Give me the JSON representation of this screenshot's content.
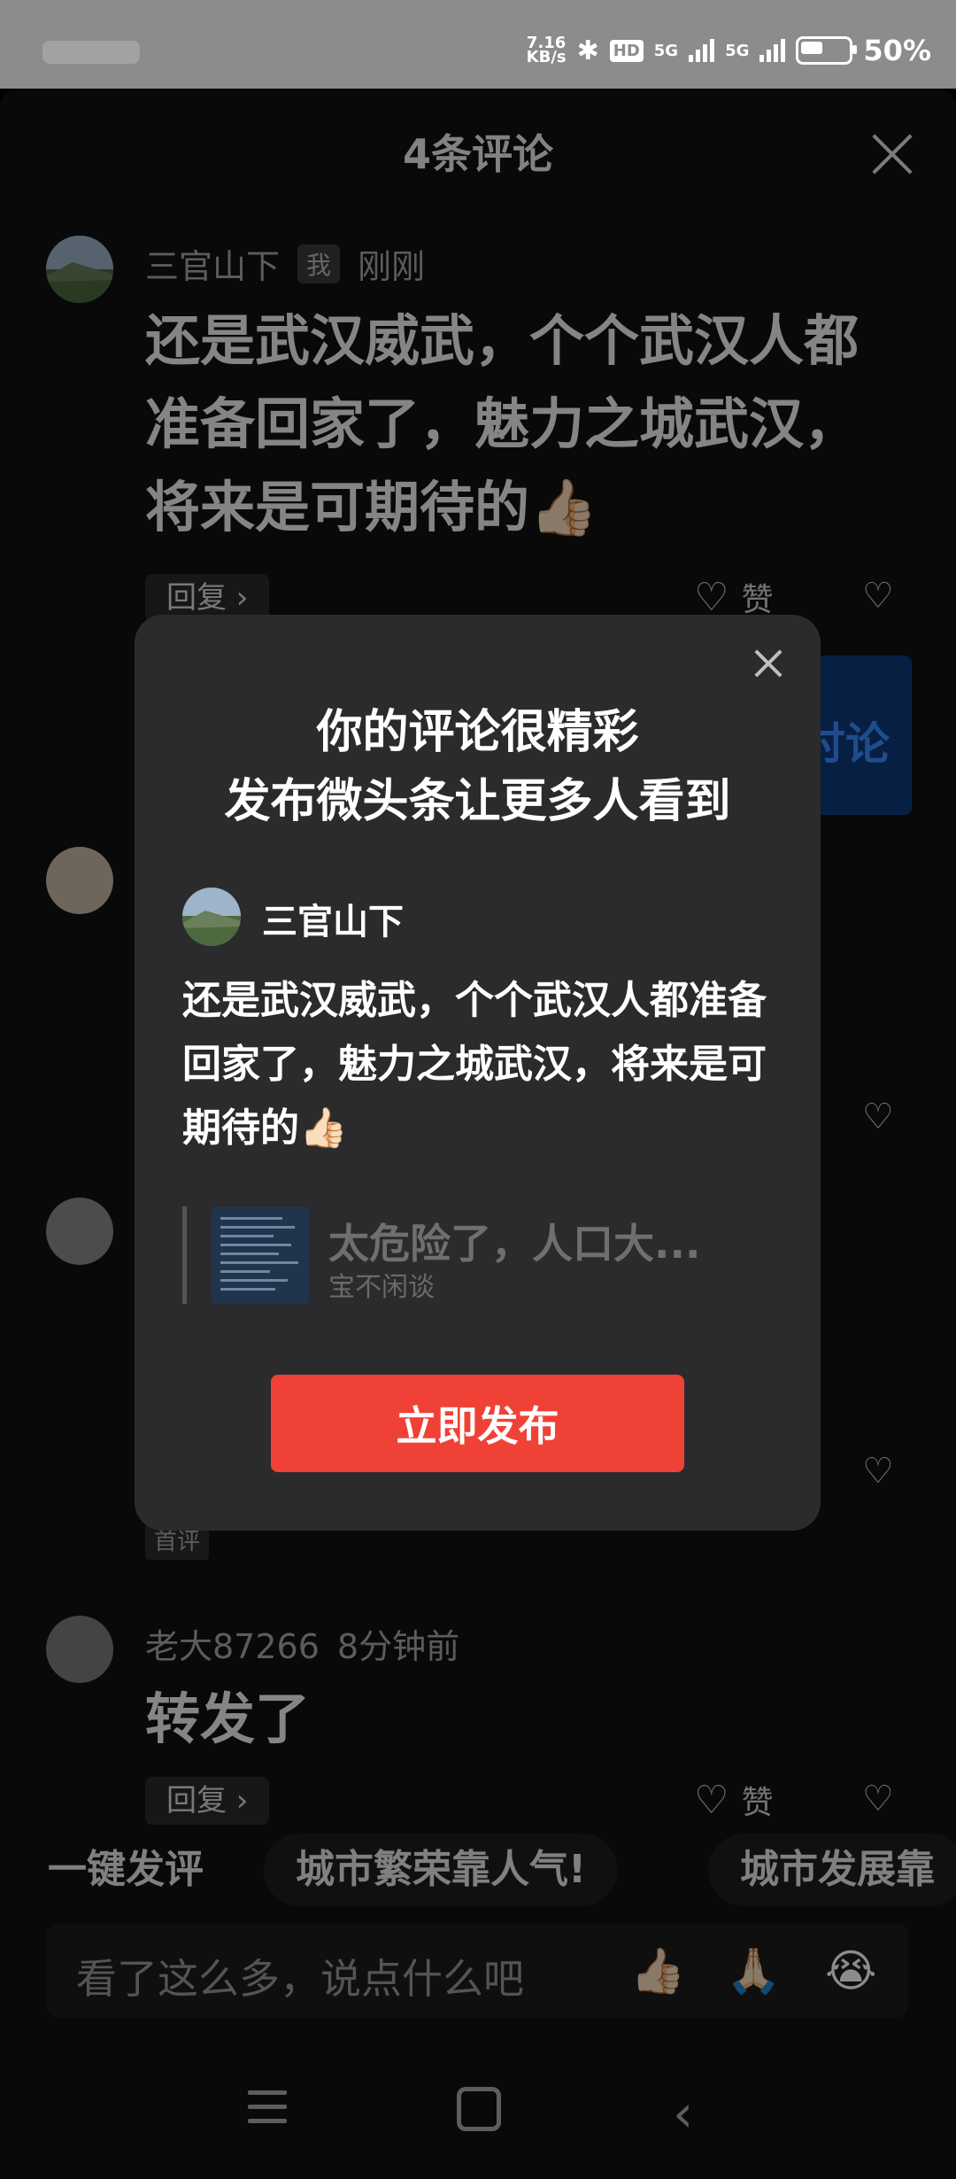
{
  "status": {
    "net_speed_value": "7.16",
    "net_speed_unit": "KB/s",
    "hd_label": "HD",
    "sig1_label": "5G",
    "sig2_label": "5G",
    "battery_pct": "50%"
  },
  "header": {
    "title": "4条评论"
  },
  "comments": [
    {
      "username": "三官山下",
      "tag": "我",
      "time": "刚刚",
      "text": "还是武汉威武，个个武汉人都准备回家了，魅力之城武汉，将来是可期待的👍🏻",
      "reply_label": "回复 ›",
      "like_label": "赞"
    },
    {
      "username": "老大87266",
      "time": "8分钟前",
      "text": "转发了",
      "reply_label": "回复 ›",
      "like_label": "赞"
    }
  ],
  "side": {
    "discuss_label": "讨论",
    "first_comment_tag": "首评"
  },
  "quick_replies": {
    "items": [
      "一键发评",
      "城市繁荣靠人气!",
      "城市发展靠"
    ]
  },
  "input": {
    "placeholder": "看了这么多，说点什么吧",
    "emojis": [
      "👍🏻",
      "🙏🏻",
      "😭"
    ]
  },
  "modal": {
    "title_line1": "你的评论很精彩",
    "title_line2": "发布微头条让更多人看到",
    "username": "三官山下",
    "text": "还是武汉威武，个个武汉人都准备回家了，魅力之城武汉，将来是可期待的👍🏻",
    "quote_title": "太危险了，人口大...",
    "quote_author": "宝不闲谈",
    "publish_label": "立即发布"
  },
  "colors": {
    "accent_red": "#f04137",
    "link_blue": "#3a8bff"
  }
}
